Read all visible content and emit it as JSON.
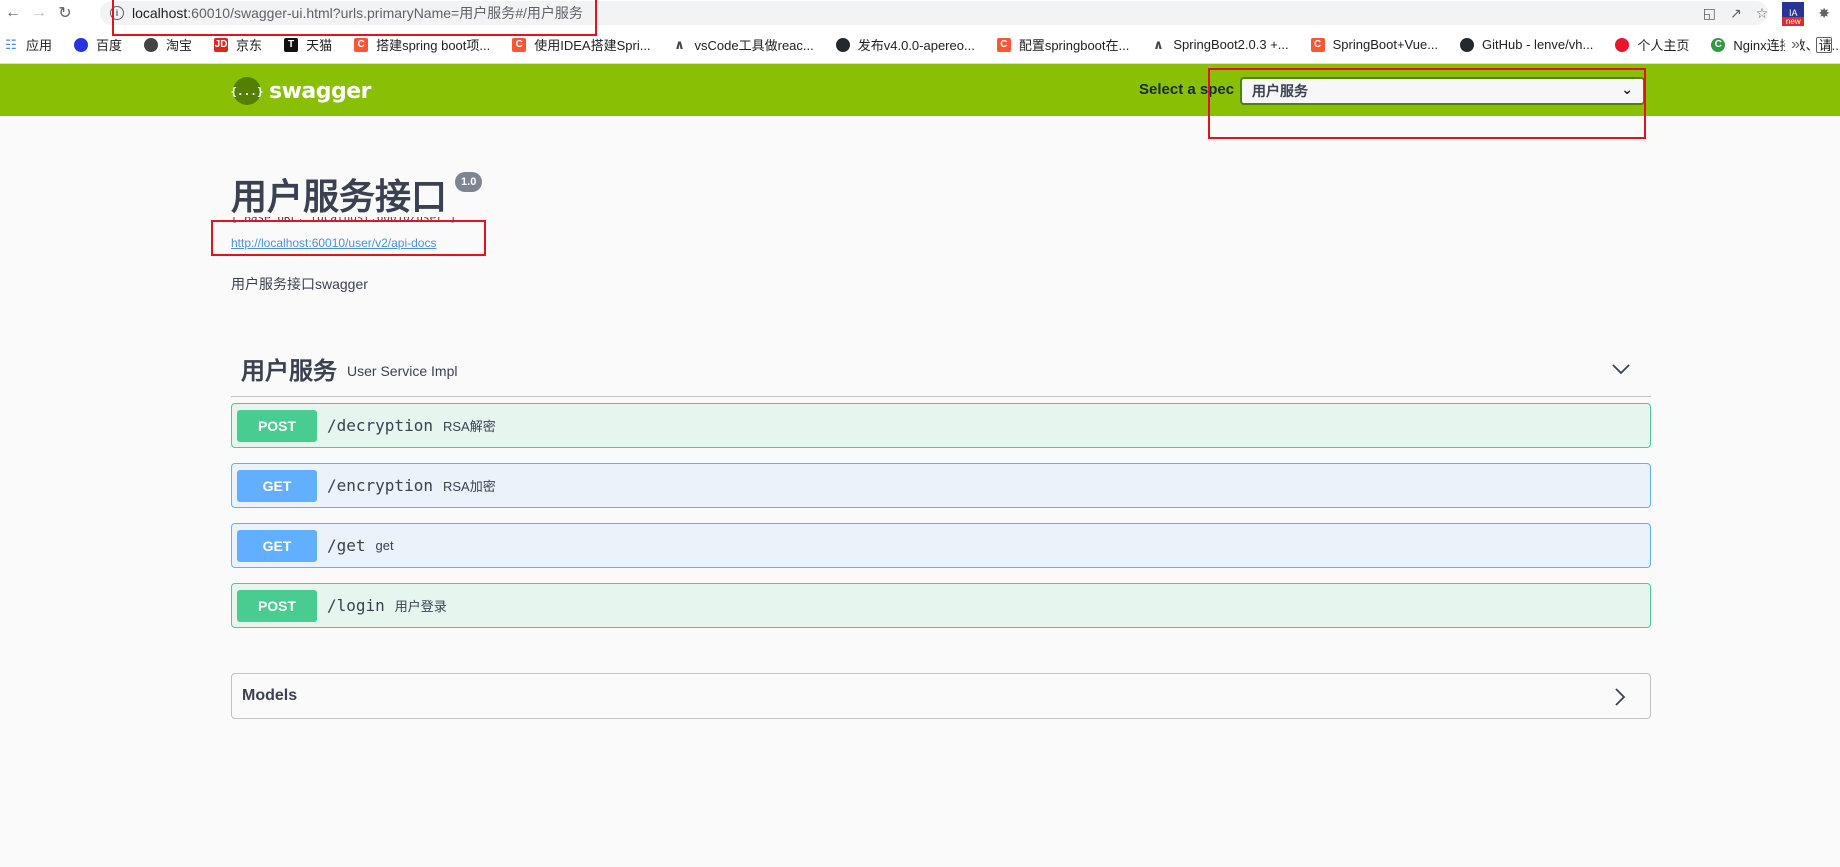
{
  "browser": {
    "url_host": "localhost",
    "url_rest": ":60010/swagger-ui.html?urls.primaryName=用户服务#/用户服务"
  },
  "bookmarks": [
    {
      "label": "应用",
      "icon": "apps-grid-icon"
    },
    {
      "label": "百度",
      "icon": "baidu-icon"
    },
    {
      "label": "淘宝",
      "icon": "taobao-icon"
    },
    {
      "label": "京东",
      "icon": "jd-icon"
    },
    {
      "label": "天猫",
      "icon": "tmall-icon"
    },
    {
      "label": "搭建spring boot项...",
      "icon": "csdn-icon"
    },
    {
      "label": "使用IDEA搭建Spri...",
      "icon": "csdn-icon"
    },
    {
      "label": "vsCode工具做reac...",
      "icon": "vue-icon"
    },
    {
      "label": "发布v4.0.0-apereo...",
      "icon": "github-icon"
    },
    {
      "label": "配置springboot在...",
      "icon": "csdn-icon"
    },
    {
      "label": "SpringBoot2.0.3 +...",
      "icon": "vue-icon"
    },
    {
      "label": "SpringBoot+Vue...",
      "icon": "csdn-icon"
    },
    {
      "label": "GitHub - lenve/vh...",
      "icon": "github-icon"
    },
    {
      "label": "个人主页",
      "icon": "weibo-icon"
    },
    {
      "label": "Nginx连接数、请...",
      "icon": "nginx-icon"
    }
  ],
  "topbar": {
    "logo_mark": "{...}",
    "logo_text": "swagger",
    "spec_label": "Select a spec",
    "spec_value": "用户服务"
  },
  "info": {
    "title": "用户服务接口",
    "version": "1.0",
    "base_url": "[ Base URL: localhost:60010/user ]",
    "api_docs_url": "http://localhost:60010/user/v2/api-docs",
    "description": "用户服务接口swagger"
  },
  "tag": {
    "name": "用户服务",
    "description": "User Service Impl"
  },
  "operations": [
    {
      "method": "POST",
      "path": "/decryption",
      "summary": "RSA解密"
    },
    {
      "method": "GET",
      "path": "/encryption",
      "summary": "RSA加密"
    },
    {
      "method": "GET",
      "path": "/get",
      "summary": "get"
    },
    {
      "method": "POST",
      "path": "/login",
      "summary": "用户登录"
    }
  ],
  "models": {
    "title": "Models"
  },
  "colors": {
    "topbar": "#89bf04",
    "post": "#49cc90",
    "get": "#61affe",
    "annotation": "#e0141e"
  }
}
